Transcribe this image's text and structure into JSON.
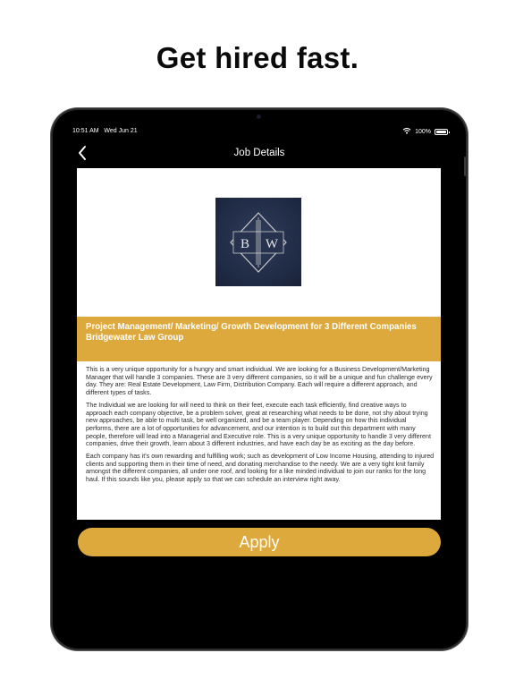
{
  "headline": "Get hired fast.",
  "status_bar": {
    "time": "10:51 AM",
    "date": "Wed Jun 21",
    "battery": "100%",
    "icons": [
      "wifi-icon",
      "battery-icon"
    ]
  },
  "navbar": {
    "title": "Job Details",
    "back_icon": "chevron-left-icon"
  },
  "company": {
    "logo_text": "B W",
    "logo_letters": [
      "B",
      "W"
    ],
    "name": "Bridgewater Law Group"
  },
  "job": {
    "title": "Project Management/ Marketing/ Growth Development for 3 Different Companies",
    "description": [
      "This is a very unique opportunity for a hungry and smart individual. We are looking for a Business Development/Marketing Manager that will handle 3 companies. These are 3 very different companies, so it will be a unique and fun challenge every day. They are: Real Estate Development, Law Firm, Distribution Company. Each will require a different approach, and different types of tasks.",
      "The Individual we are looking for will need to think on their feet, execute each task efficiently, find creative ways to approach each company objective, be a problem solver, great at researching what needs to be done, not shy about trying new approaches, be able to multi task, be well organized, and be a team player. Depending on how this individual performs, there are a lot of opportunities for advancement, and our intention is to build out this department with many people, therefore will lead into a Managerial and Executive role. This is a very unique opportunity to handle 3 very different companies, drive their growth, learn about 3 different industries, and have each day be as exciting as the day before.",
      "Each company has it's own rewarding and fulfilling work; such as development of Low Income Housing, attending to injured clients and supporting them in their time of need, and donating merchandise to the needy. We are a very tight knit family amongst the different companies, all under one roof, and looking for a like minded individual to join our ranks for the long haul. If this sounds like you, please apply so that we can schedule an interview right away."
    ]
  },
  "actions": {
    "apply_label": "Apply"
  },
  "colors": {
    "accent": "#dda93c",
    "background": "#000000",
    "logo_bg": "#1f2a44",
    "logo_frame": "#c9c9c9"
  }
}
